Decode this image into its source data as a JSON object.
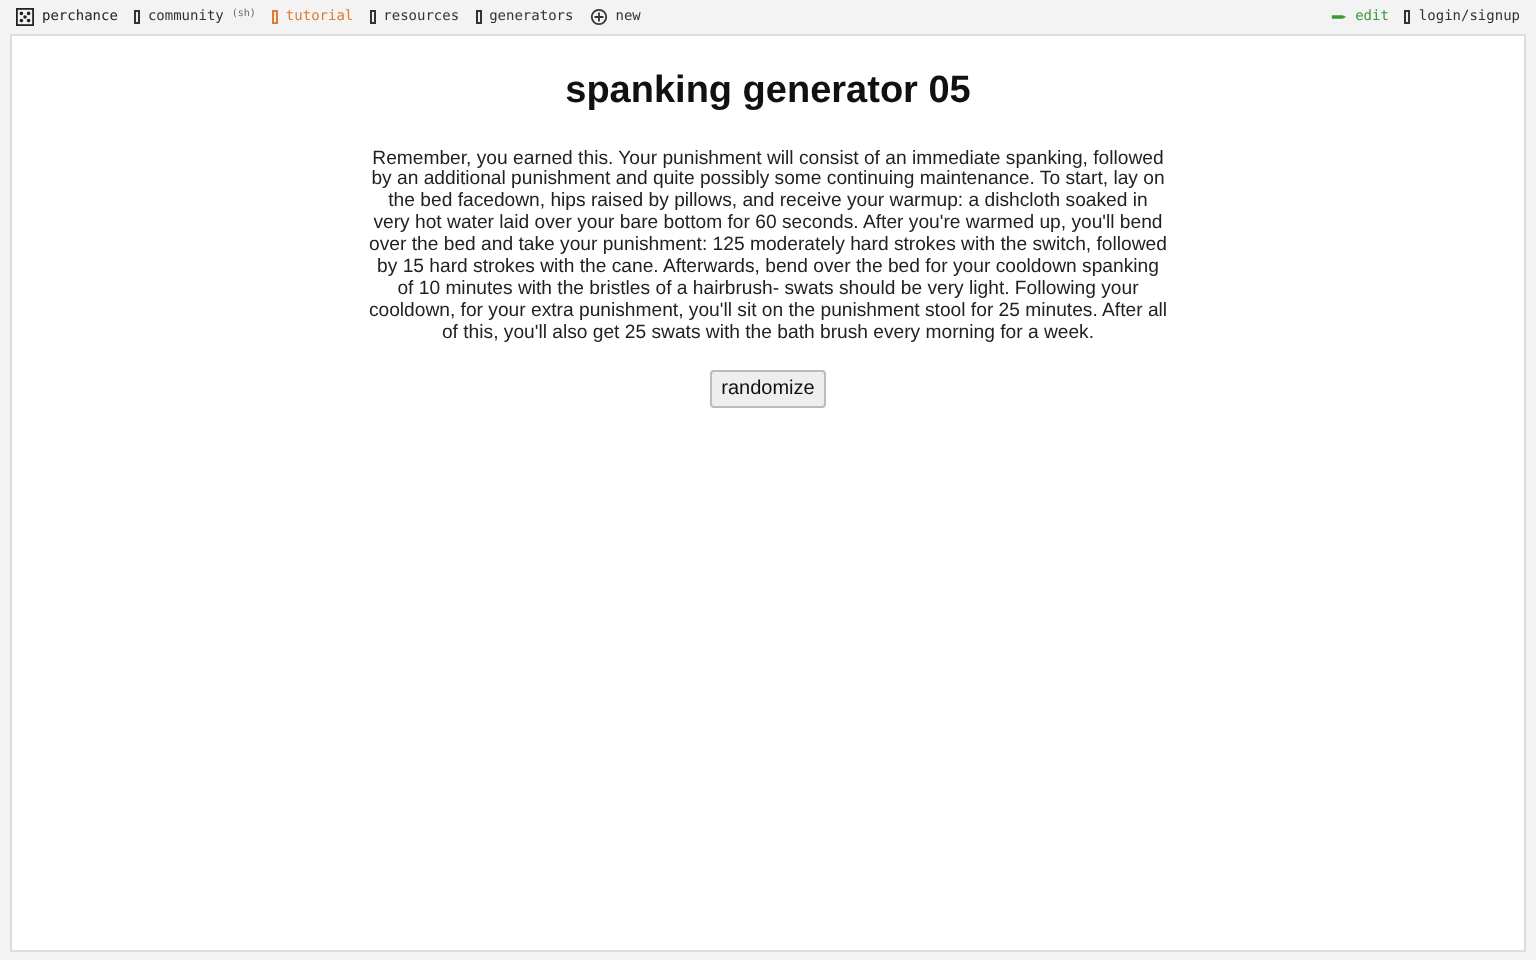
{
  "topbar": {
    "brand": "perchance",
    "items": [
      {
        "label": "community",
        "note": "(sh)",
        "color": "#333333",
        "kind": "glyph"
      },
      {
        "label": "tutorial",
        "color": "#e07b30",
        "kind": "glyph"
      },
      {
        "label": "resources",
        "color": "#333333",
        "kind": "glyph"
      },
      {
        "label": "generators",
        "color": "#333333",
        "kind": "glyph"
      },
      {
        "label": "new",
        "color": "#333333",
        "kind": "plus"
      }
    ],
    "right": [
      {
        "label": "edit",
        "color": "#3a9a3a",
        "kind": "pencil"
      },
      {
        "label": "login/signup",
        "color": "#333333",
        "kind": "glyph"
      }
    ]
  },
  "page": {
    "title": "spanking generator 05",
    "text": "Remember, you earned this. Your punishment will consist of an immediate spanking, followed by an additional punishment and quite possibly some continuing maintenance. To start, lay on the bed facedown, hips raised by pillows, and receive your warmup: a dishcloth soaked in very hot water laid over your bare bottom for 60 seconds. After you're warmed up, you'll bend over the bed and take your punishment: 125 moderately hard strokes with the switch, followed by 15 hard strokes with the cane. Afterwards, bend over the bed for your cooldown spanking of 10 minutes with the bristles of a hairbrush- swats should be very light. Following your cooldown, for your extra punishment, you'll sit on the punishment stool for 25 minutes. After all of this, you'll also get 25 swats with the bath brush every morning for a week.",
    "button": "randomize"
  }
}
